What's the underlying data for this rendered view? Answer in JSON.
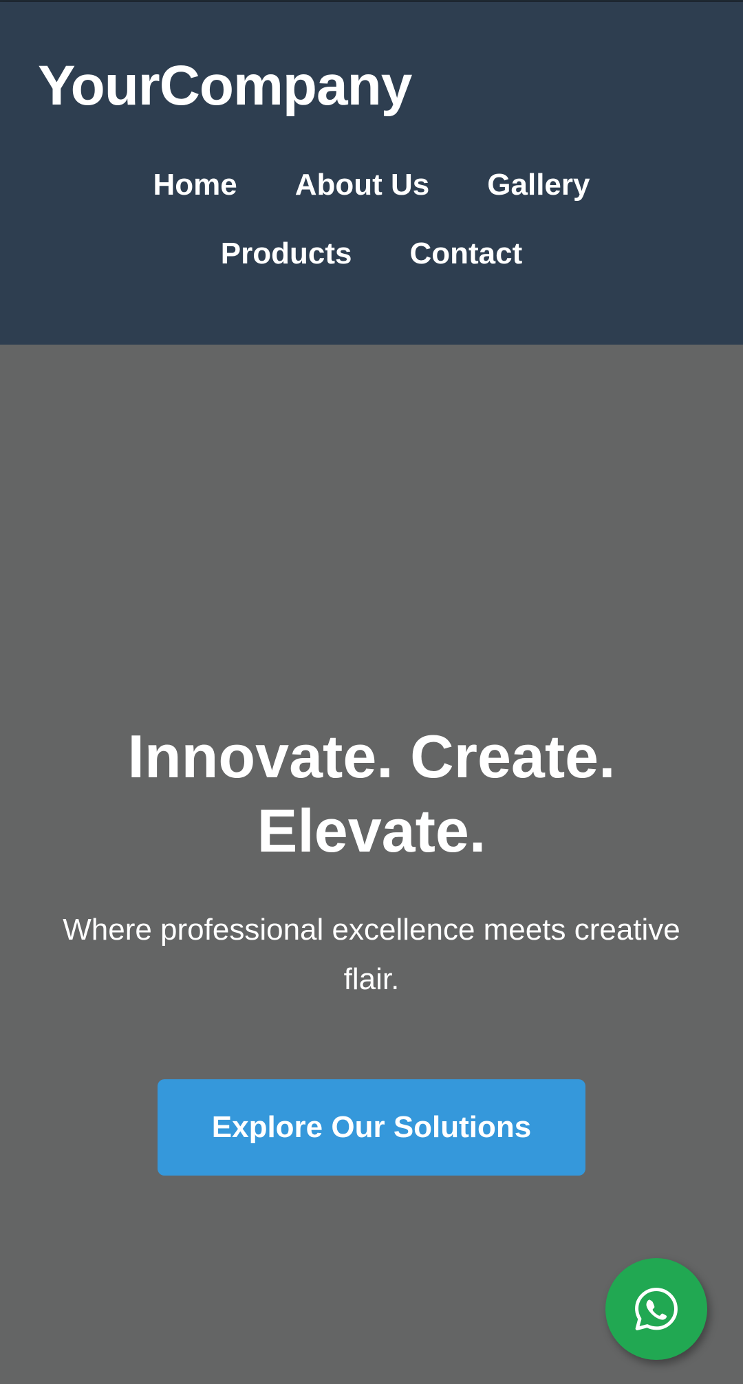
{
  "header": {
    "logo": "YourCompany",
    "nav": [
      {
        "label": "Home"
      },
      {
        "label": "About Us"
      },
      {
        "label": "Gallery"
      },
      {
        "label": "Products"
      },
      {
        "label": "Contact"
      }
    ]
  },
  "hero": {
    "title": "Innovate. Create. Elevate.",
    "subtitle": "Where professional excellence meets creative flair.",
    "cta_label": "Explore Our Solutions"
  },
  "floating": {
    "whatsapp_icon": "whatsapp-icon"
  },
  "colors": {
    "header_bg": "#2e3e50",
    "hero_bg": "#646565",
    "accent": "#3598db",
    "whatsapp": "#21a852"
  }
}
